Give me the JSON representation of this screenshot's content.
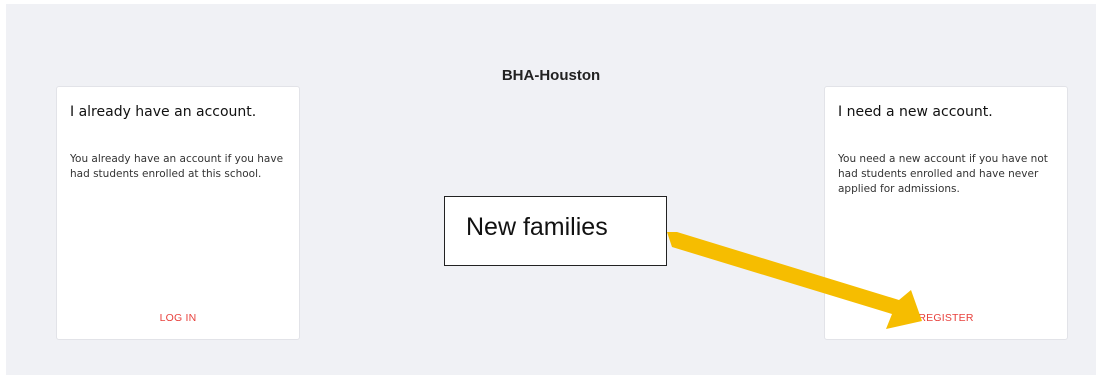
{
  "school": {
    "title": "BHA-Houston"
  },
  "cards": {
    "existing": {
      "heading": "I already have an account.",
      "body": "You already have an account if you have had students enrolled at this school.",
      "action_label": "LOG IN"
    },
    "new": {
      "heading": "I need a new account.",
      "body": "You need a new account if you have not had students enrolled and have never applied for admissions.",
      "action_label": "REGISTER"
    }
  },
  "annotation": {
    "callout_text": "New families",
    "arrow_color": "#f6bd00"
  },
  "colors": {
    "background": "#f0f1f5",
    "card": "#ffffff",
    "action": "#e8403c"
  }
}
